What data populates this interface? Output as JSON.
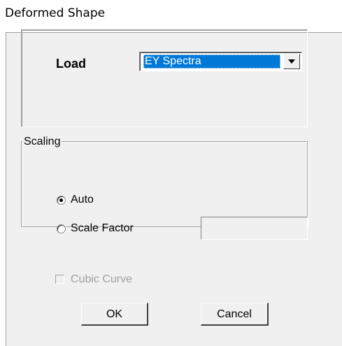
{
  "window": {
    "title": "Deformed Shape"
  },
  "load": {
    "label": "Load",
    "selected": "EY Spectra"
  },
  "scaling": {
    "legend": "Scaling",
    "options": [
      {
        "label": "Auto",
        "checked": true
      },
      {
        "label": "Scale Factor",
        "checked": false
      }
    ],
    "scale_factor_value": ""
  },
  "cubic_curve": {
    "label": "Cubic Curve",
    "checked": false,
    "enabled": false
  },
  "buttons": {
    "ok": "OK",
    "cancel": "Cancel"
  },
  "icons": {
    "dropdown": "chevron-down-icon"
  }
}
